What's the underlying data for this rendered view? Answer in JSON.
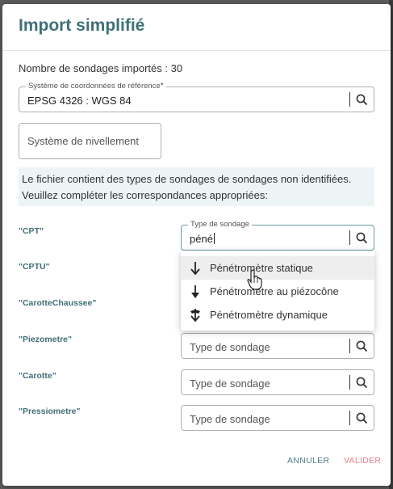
{
  "dialog": {
    "title": "Import simplifié",
    "imported_count_text": "Nombre de sondages importés : 30",
    "crs": {
      "legend": "Système de coordonnées de référence",
      "required_mark": "*",
      "value": "EPSG 4326 : WGS 84"
    },
    "leveling": {
      "placeholder": "Système de nivellement"
    },
    "info": {
      "line1": "Le fichier contient des types de sondages de sondages non identifiées.",
      "line2": "Veuillez compléter les correspondances appropriées:"
    },
    "mappings": [
      {
        "label": "\"CPT\"",
        "legend": "Type de sondage",
        "value": "péné"
      },
      {
        "label": "\"CPTU\""
      },
      {
        "label": "\"CarotteChaussee\""
      },
      {
        "label": "\"Piezometre\"",
        "placeholder": "Type de sondage"
      },
      {
        "label": "\"Carotte\"",
        "placeholder": "Type de sondage"
      },
      {
        "label": "\"Pressiometre\"",
        "placeholder": "Type de sondage"
      }
    ],
    "dropdown": {
      "options": [
        {
          "label": "Pénétromètre statique",
          "icon": "arrow-down-icon"
        },
        {
          "label": "Pénétromètre au piézocône",
          "icon": "arrow-down-filled-icon"
        },
        {
          "label": "Pénétromètre dynamique",
          "icon": "hammer-arrow-down-icon"
        }
      ]
    },
    "buttons": {
      "cancel": "ANNULER",
      "validate": "VALIDER"
    }
  },
  "colors": {
    "title": "#3f6f78",
    "cancel": "#4f7e86",
    "validate": "#e8808a",
    "info_bg": "#edf4f5"
  }
}
